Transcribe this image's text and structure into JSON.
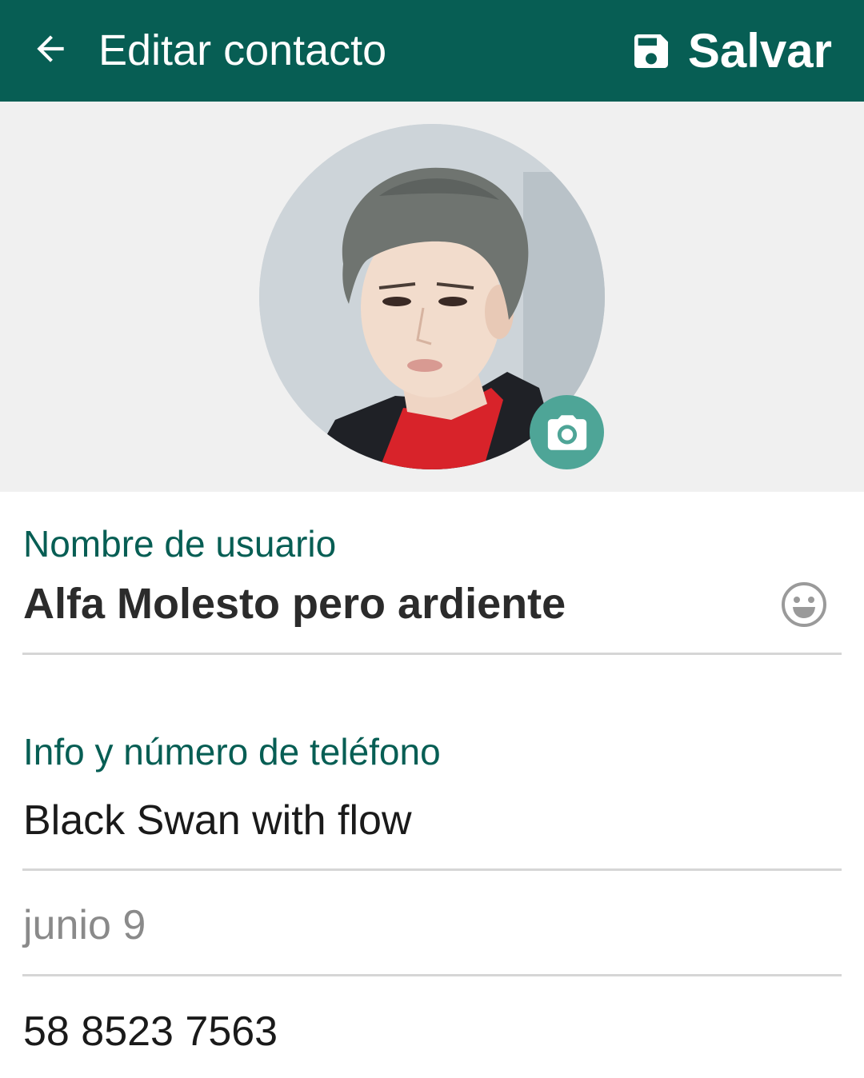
{
  "appbar": {
    "title": "Editar contacto",
    "save_label": "Salvar",
    "background": "#075e54",
    "icons": [
      "arrow-back-icon",
      "floppy-disk-icon"
    ]
  },
  "profile": {
    "photo": "profile-photo",
    "camera_icon": "camera-icon",
    "camera_button_color": "#4ea597"
  },
  "username_section": {
    "label": "Nombre de usuario",
    "value": "Alfa Molesto pero ardiente",
    "emoji_icon": "smiley-icon"
  },
  "info_section": {
    "label": "Info y número de teléfono",
    "about": "Black Swan with flow",
    "date": "junio 9",
    "phone": "58 8523 7563"
  },
  "colors": {
    "accent": "#075e54",
    "divider": "#d6d6d6",
    "photo_background": "#f0f0f0"
  }
}
